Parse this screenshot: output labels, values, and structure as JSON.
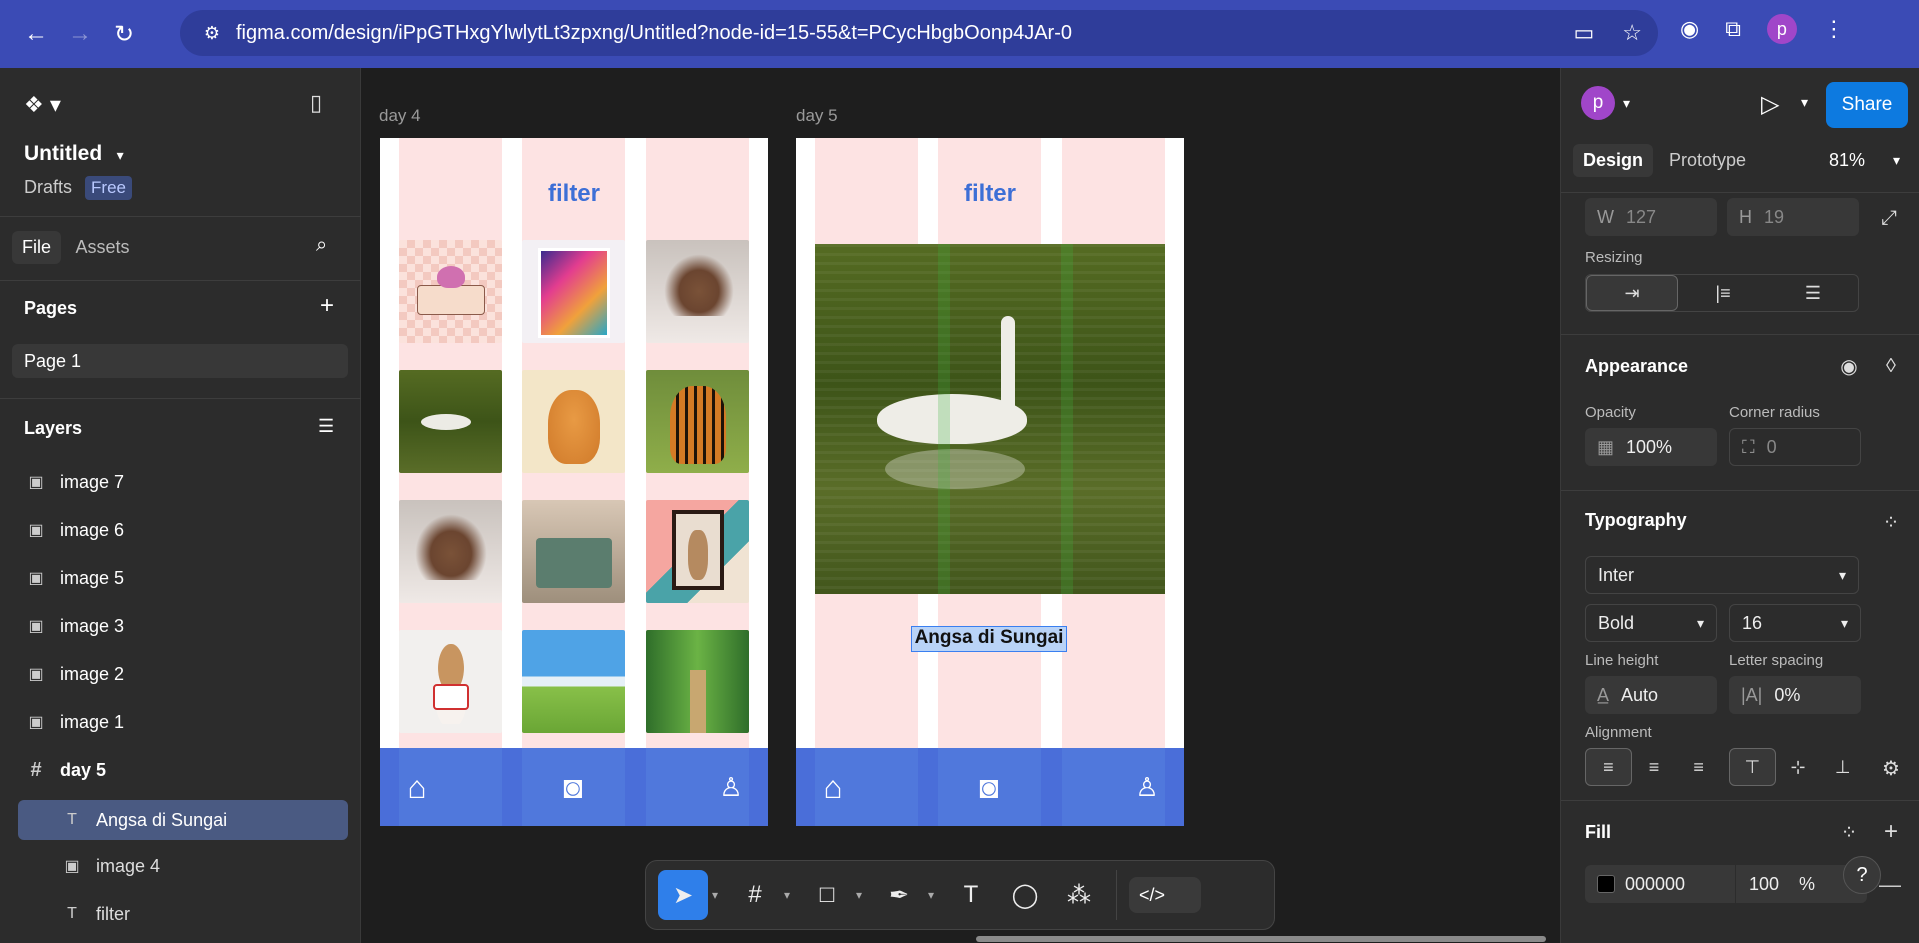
{
  "browser": {
    "url": "figma.com/design/iPpGTHxgYlwlytLt3zpxng/Untitled?node-id=15-55&t=PCycHbgbOonp4JAr-0",
    "profile_initial": "p"
  },
  "left_panel": {
    "file_name": "Untitled",
    "location": "Drafts",
    "plan_badge": "Free",
    "tabs": [
      "File",
      "Assets"
    ],
    "pages_heading": "Pages",
    "pages": [
      "Page 1"
    ],
    "layers_heading": "Layers",
    "layers": [
      {
        "name": "image 7",
        "icon": "image-icon"
      },
      {
        "name": "image 6",
        "icon": "image-icon"
      },
      {
        "name": "image 5",
        "icon": "image-icon"
      },
      {
        "name": "image 3",
        "icon": "image-icon"
      },
      {
        "name": "image 2",
        "icon": "image-icon"
      },
      {
        "name": "image 1",
        "icon": "image-icon"
      },
      {
        "name": "day 5",
        "icon": "frame-icon"
      },
      {
        "name": "Angsa di Sungai",
        "icon": "text-icon",
        "selected": true
      },
      {
        "name": "image 4",
        "icon": "image-icon"
      },
      {
        "name": "filter",
        "icon": "text-icon"
      }
    ]
  },
  "canvas": {
    "frames": [
      {
        "label": "day 4",
        "heading": "filter"
      },
      {
        "label": "day 5",
        "heading": "filter",
        "caption": "Angsa di Sungai"
      }
    ]
  },
  "right_panel": {
    "avatar_initial": "p",
    "share_label": "Share",
    "tabs": [
      "Design",
      "Prototype"
    ],
    "zoom": "81%",
    "w_label": "W",
    "w_value": "127",
    "h_label": "H",
    "h_value": "19",
    "resizing_label": "Resizing",
    "appearance_title": "Appearance",
    "opacity_label": "Opacity",
    "opacity_value": "100%",
    "corner_radius_label": "Corner radius",
    "corner_radius_value": "0",
    "typography_title": "Typography",
    "font_family": "Inter",
    "font_weight": "Bold",
    "font_size": "16",
    "line_height_label": "Line height",
    "line_height_value": "Auto",
    "letter_spacing_label": "Letter spacing",
    "letter_spacing_value": "0%",
    "alignment_label": "Alignment",
    "fill_title": "Fill",
    "fill_hex": "000000",
    "fill_opacity": "100",
    "fill_percent": "%",
    "help": "?"
  },
  "colors": {
    "accent": "#0d7ae0",
    "frame_pink": "#fde3e3",
    "nav_blue": "#4a6ed9",
    "filter_blue": "#3d6fd6"
  }
}
